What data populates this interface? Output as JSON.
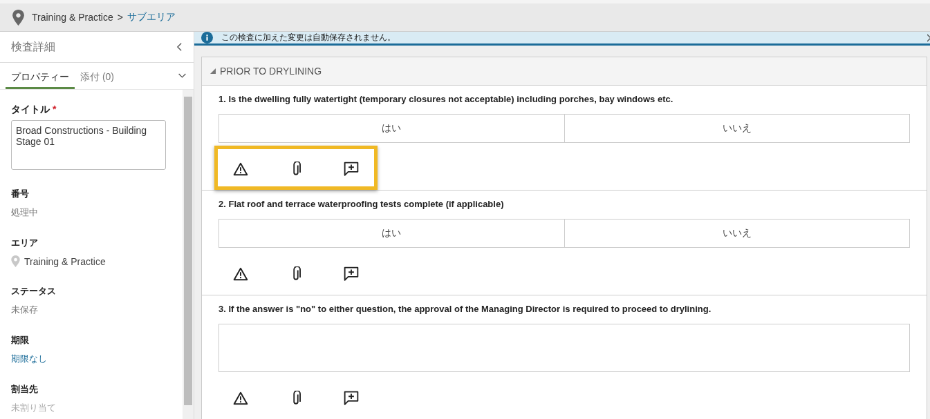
{
  "breadcrumb": {
    "items": [
      {
        "label": "Training & Practice",
        "link": false
      },
      {
        "label": "サブエリア",
        "link": true
      }
    ],
    "separator": ">"
  },
  "sidebar": {
    "title": "検査詳細",
    "tabs": [
      {
        "label": "プロパティー",
        "selected": true
      },
      {
        "label": "添付 (0)",
        "selected": false
      }
    ],
    "title_field": {
      "label": "タイトル",
      "required_mark": "*",
      "value": "Broad Constructions - Building Stage 01"
    },
    "fields": [
      {
        "label": "番号",
        "value": "処理中",
        "kind": "plain"
      },
      {
        "label": "エリア",
        "value": "Training & Practice",
        "kind": "location"
      },
      {
        "label": "ステータス",
        "value": "未保存",
        "kind": "plain"
      },
      {
        "label": "期限",
        "value": "期限なし",
        "kind": "link"
      },
      {
        "label": "割当先",
        "value": "未割り当て",
        "kind": "muted"
      }
    ]
  },
  "banner": {
    "text": "この検査に加えた変更は自動保存されません。"
  },
  "section": {
    "title": "PRIOR TO DRYLINING",
    "expanded": true,
    "questions": [
      {
        "text": "1. Is the dwelling fully watertight (temporary closures not acceptable) including porches, bay windows etc.",
        "kind": "choice",
        "options": [
          "はい",
          "いいえ"
        ],
        "highlighted": true
      },
      {
        "text": "2. Flat roof and terrace waterproofing tests complete (if applicable)",
        "kind": "choice",
        "options": [
          "はい",
          "いいえ"
        ],
        "highlighted": false
      },
      {
        "text": "3. If the answer is \"no\" to either question, the approval of the Managing Director is required to proceed to drylining.",
        "kind": "text",
        "highlighted": false
      }
    ]
  }
}
